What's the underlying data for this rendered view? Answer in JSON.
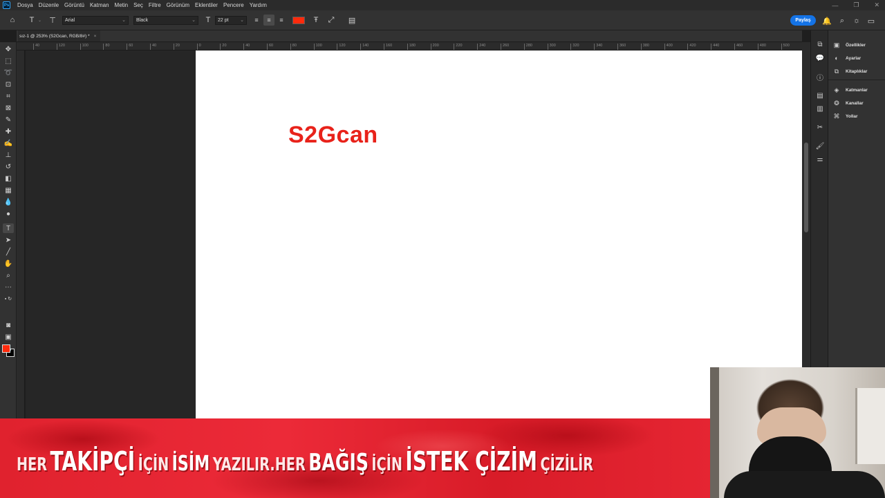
{
  "menu": {
    "app_icon": "photoshop-logo",
    "items": [
      "Dosya",
      "Düzenle",
      "Görüntü",
      "Katman",
      "Metin",
      "Seç",
      "Filtre",
      "Görünüm",
      "Eklentiler",
      "Pencere",
      "Yardım"
    ]
  },
  "options": {
    "font_family": "Arial",
    "font_style": "Black",
    "font_size": "22 pt",
    "text_color": "#ff2a0c",
    "share_label": "Paylaş"
  },
  "document": {
    "tab_title": "sız-1 @ 253% (S2Gcan, RGB/8#) *",
    "canvas_text": "S2Gcan",
    "canvas_text_color": "#e8221a"
  },
  "rulers": {
    "h_ticks": [
      "40",
      "120",
      "100",
      "80",
      "60",
      "40",
      "20",
      "0",
      "20",
      "40",
      "60",
      "80",
      "100",
      "120",
      "140",
      "160",
      "180",
      "200",
      "220",
      "240",
      "260",
      "280",
      "300",
      "320",
      "340",
      "360",
      "380",
      "400",
      "420",
      "440",
      "460",
      "480",
      "500"
    ]
  },
  "panels": {
    "items": [
      "Özellikler",
      "Ayarlar",
      "Kitaplıklar",
      "Katmanlar",
      "Kanallar",
      "Yollar"
    ]
  },
  "overlay": {
    "segments": [
      {
        "text": "HER",
        "size": "small"
      },
      {
        "text": "TAKİPÇİ",
        "size": "big"
      },
      {
        "text": "İÇİN",
        "size": "small"
      },
      {
        "text": "İSİM",
        "size": "big-mid"
      },
      {
        "text": "YAZILIR.HER",
        "size": "small"
      },
      {
        "text": "BAĞIŞ",
        "size": "big-mid"
      },
      {
        "text": "İÇİN",
        "size": "small"
      },
      {
        "text": "İSTEK ÇİZİM",
        "size": "big"
      },
      {
        "text": "ÇİZİLİR",
        "size": "small"
      }
    ],
    "banner_color": "#e0222e"
  }
}
